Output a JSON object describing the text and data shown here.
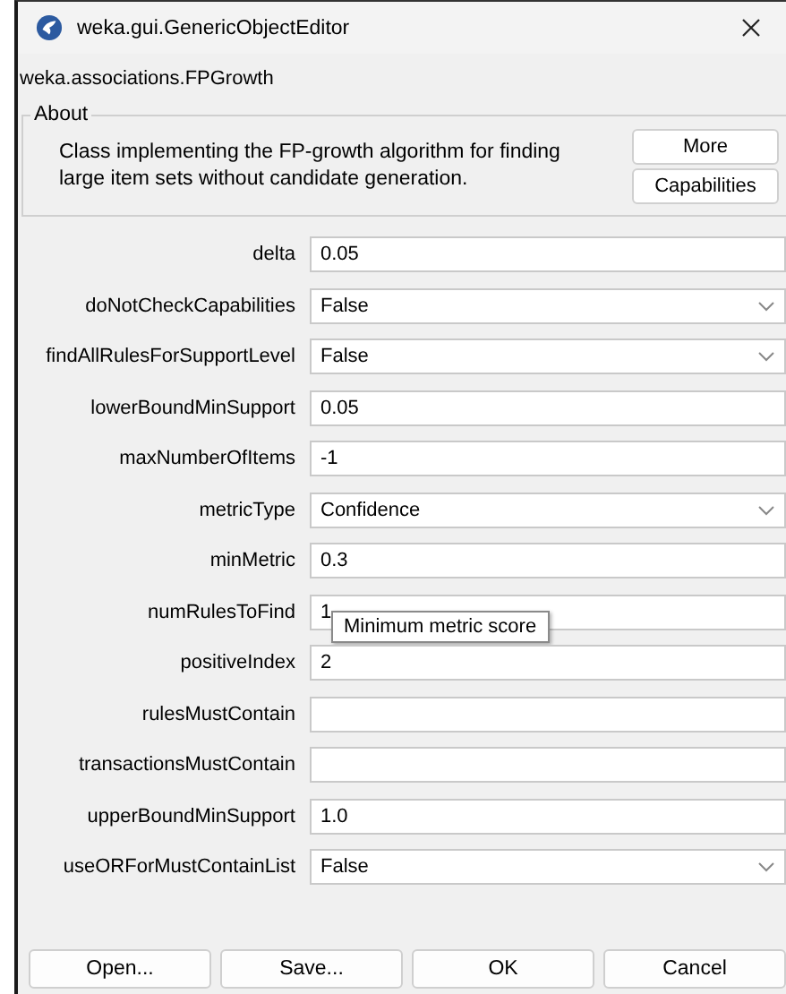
{
  "window": {
    "title": "weka.gui.GenericObjectEditor"
  },
  "class_name": "weka.associations.FPGrowth",
  "about": {
    "title": "About",
    "text": "Class implementing the FP-growth algorithm for finding large item sets without candidate generation.",
    "buttons": [
      "More",
      "Capabilities"
    ]
  },
  "properties": [
    {
      "label": "delta",
      "kind": "text",
      "value": "0.05"
    },
    {
      "label": "doNotCheckCapabilities",
      "kind": "dropdown",
      "value": "False"
    },
    {
      "label": "findAllRulesForSupportLevel",
      "kind": "dropdown",
      "value": "False"
    },
    {
      "label": "lowerBoundMinSupport",
      "kind": "text",
      "value": "0.05"
    },
    {
      "label": "maxNumberOfItems",
      "kind": "text",
      "value": "-1"
    },
    {
      "label": "metricType",
      "kind": "dropdown",
      "value": "Confidence"
    },
    {
      "label": "minMetric",
      "kind": "text",
      "value": "0.3"
    },
    {
      "label": "numRulesToFind",
      "kind": "text",
      "value": "1",
      "tooltip": "Minimum metric score"
    },
    {
      "label": "positiveIndex",
      "kind": "text",
      "value": "2"
    },
    {
      "label": "rulesMustContain",
      "kind": "text"
    },
    {
      "label": "transactionsMustContain",
      "kind": "text"
    },
    {
      "label": "upperBoundMinSupport",
      "kind": "text",
      "value": "1.0"
    },
    {
      "label": "useORForMustContainList",
      "kind": "dropdown",
      "value": "False"
    }
  ],
  "buttons": [
    "Open...",
    "Save...",
    "OK",
    "Cancel"
  ]
}
